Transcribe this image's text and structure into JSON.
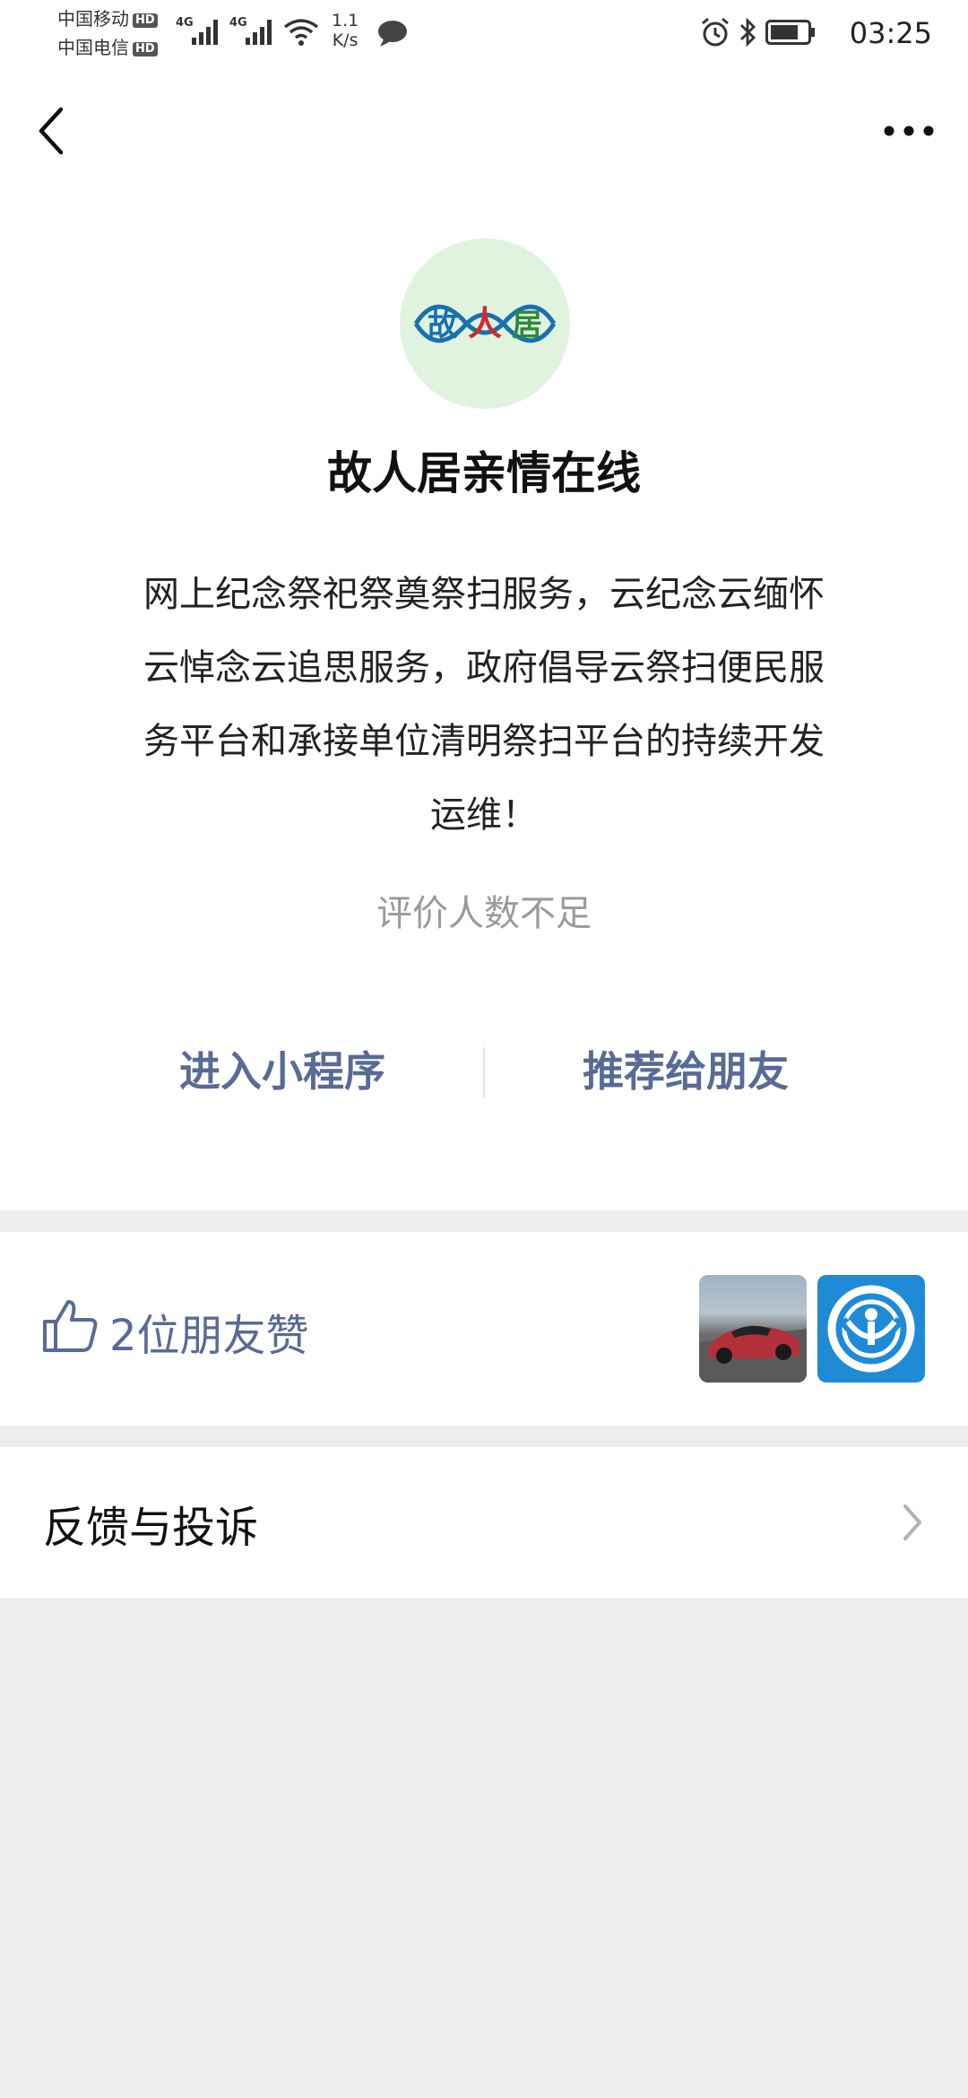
{
  "status_bar": {
    "carrier1": "中国移动",
    "carrier2": "中国电信",
    "hd_label": "HD",
    "signal1_label": "4G",
    "signal2_label": "4G",
    "speed_value": "1.1",
    "speed_unit": "K/s",
    "time": "03:25",
    "icons": [
      "wifi-icon",
      "chat-bubble-icon",
      "alarm-icon",
      "bluetooth-icon",
      "battery-icon"
    ]
  },
  "nav": {
    "back_icon": "chevron-left-icon",
    "more_icon": "more-dots-icon"
  },
  "app": {
    "logo_text_1": "故",
    "logo_text_2": "人",
    "logo_text_3": "居",
    "name": "故人居亲情在线",
    "description": "网上纪念祭祀祭奠祭扫服务，云纪念云缅怀云悼念云追思服务，政府倡导云祭扫便民服务平台和承接单位清明祭扫平台的持续开发运维！",
    "rating_text": "评价人数不足"
  },
  "actions": {
    "enter_label": "进入小程序",
    "share_label": "推荐给朋友"
  },
  "likes": {
    "text": "2位朋友赞",
    "icon": "thumbs-up-icon"
  },
  "feedback": {
    "label": "反馈与投诉",
    "icon": "chevron-right-icon"
  },
  "colors": {
    "link_blue": "#576b95",
    "logo_bg": "#dff3df",
    "page_bg": "#ededed"
  }
}
